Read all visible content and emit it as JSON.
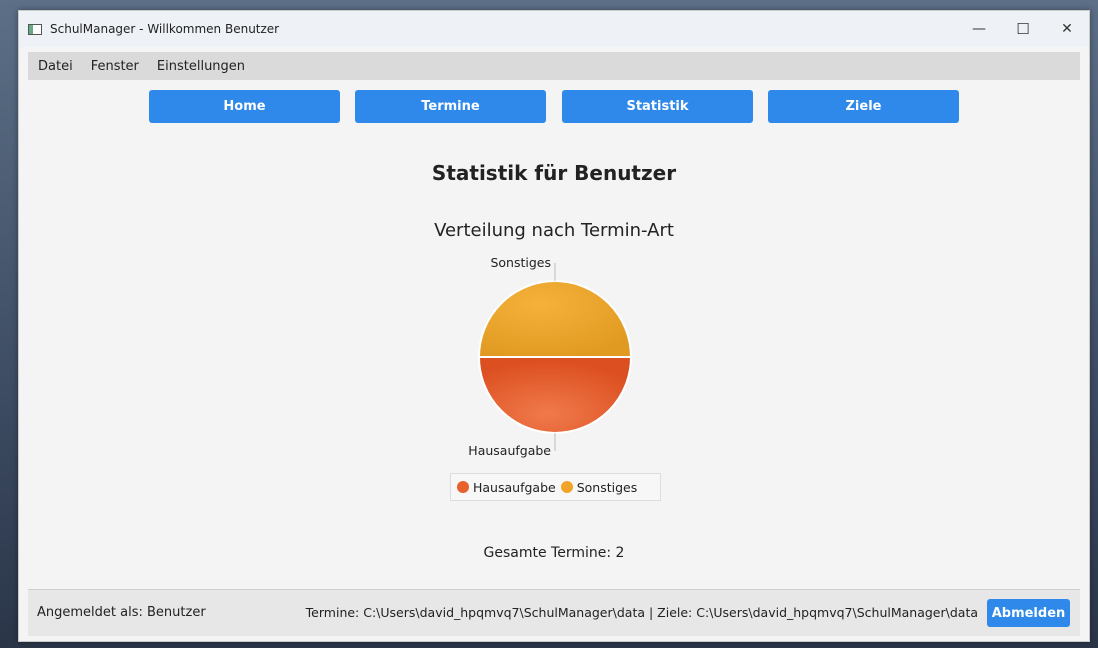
{
  "window": {
    "title": "SchulManager - Willkommen Benutzer",
    "controls": {
      "minimize": "—",
      "maximize": "☐",
      "close": "✕"
    }
  },
  "menu": {
    "items": [
      "Datei",
      "Fenster",
      "Einstellungen"
    ]
  },
  "nav": {
    "buttons": [
      "Home",
      "Termine",
      "Statistik",
      "Ziele"
    ]
  },
  "main": {
    "heading": "Statistik für Benutzer",
    "chart_title": "Verteilung nach Termin-Art",
    "total": "Gesamte Termine: 2"
  },
  "chart_data": {
    "type": "pie",
    "title": "Verteilung nach Termin-Art",
    "slices": [
      {
        "label": "Hausaufgabe",
        "value": 1,
        "color": "#e8602c"
      },
      {
        "label": "Sonstiges",
        "value": 1,
        "color": "#f0a429"
      }
    ],
    "legend": [
      "Hausaufgabe",
      "Sonstiges"
    ],
    "legend_position": "bottom"
  },
  "status": {
    "user": "Angemeldet als: Benutzer",
    "paths": "Termine: C:\\Users\\david_hpqmvq7\\SchulManager\\data | Ziele: C:\\Users\\david_hpqmvq7\\SchulManager\\data",
    "logout": "Abmelden"
  },
  "colors": {
    "accent": "#2f89ea",
    "hausaufgabe": "#e8602c",
    "sonstiges": "#f0a429"
  }
}
